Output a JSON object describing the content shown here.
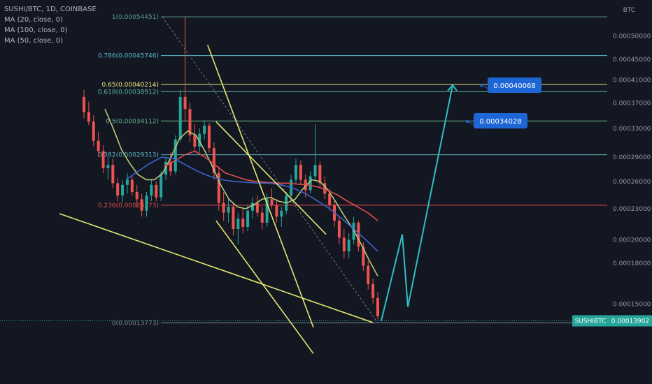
{
  "header": {
    "symbol": "SUSHI/BTC, 1D, COINBASE",
    "indicators": [
      "MA (20, close, 0)",
      "MA (100, close, 0)",
      "MA (50, close, 0)"
    ],
    "unit": "BTC"
  },
  "price_tag": {
    "symbol": "SUSHIBTC",
    "value": "0.00013902"
  },
  "callouts": [
    "0.00040068",
    "0.00034028"
  ],
  "colors": {
    "bg": "#131722",
    "up": "#26a69a",
    "down": "#ef5350",
    "ma20": "#b5c97a",
    "ma50": "#e24c4c",
    "ma100": "#3a63c9",
    "trend": "#e6e672",
    "arrow": "#2ebfc2",
    "callout": "#1e66d6",
    "tag": "#26a69a"
  },
  "chart_data": {
    "type": "candlestick",
    "y_axis_ticks": [
      "0.00050000",
      "0.00045000",
      "0.00041000",
      "0.00037000",
      "0.00033000",
      "0.00029000",
      "0.00026000",
      "0.00023000",
      "0.00020000",
      "0.00018000",
      "0.00015000"
    ],
    "fib_levels": [
      {
        "label": "1(0.00054451)",
        "value": 0.00054451,
        "color": "#5b9c8f"
      },
      {
        "label": "0.786(0.00045746)",
        "value": 0.00045746,
        "color": "#5ab9c9"
      },
      {
        "label": "0.65(0.00040214)",
        "value": 0.00040214,
        "color": "#f0eb7a"
      },
      {
        "label": "0.618(0.00038912)",
        "value": 0.00038912,
        "color": "#5bbaa5"
      },
      {
        "label": "0.5(0.00034112)",
        "value": 0.00034112,
        "color": "#67b089"
      },
      {
        "label": "0.382(0.00029313)",
        "value": 0.00029313,
        "color": "#5cb5c0"
      },
      {
        "label": "0.236(0.00023373)",
        "value": 0.00023373,
        "color": "#e04a4a"
      },
      {
        "label": "0(0.00013773)",
        "value": 0.00013773,
        "color": "#7a8a95"
      }
    ],
    "last_price": 0.00013902,
    "targets": [
      0.00040068,
      0.00034028
    ],
    "trendlines": [
      {
        "from": [
          0.0,
          0.000225
        ],
        "to": [
          0.74,
          0.000138
        ]
      },
      {
        "from": [
          0.35,
          0.00048
        ],
        "to": [
          0.6,
          0.000135
        ]
      },
      {
        "from": [
          0.37,
          0.00034
        ],
        "to": [
          0.63,
          0.000205
        ]
      },
      {
        "from": [
          0.37,
          0.000218
        ],
        "to": [
          0.6,
          0.00012
        ]
      }
    ],
    "series": [
      {
        "type": "candles",
        "values": [
          [
            0.00038,
            0.000392,
            0.000345,
            0.000355
          ],
          [
            0.000355,
            0.000372,
            0.000335,
            0.00034
          ],
          [
            0.00034,
            0.00035,
            0.000305,
            0.000312
          ],
          [
            0.000312,
            0.000325,
            0.00029,
            0.000298
          ],
          [
            0.000298,
            0.000306,
            0.00027,
            0.000276
          ],
          [
            0.000276,
            0.00029,
            0.000262,
            0.00028
          ],
          [
            0.00028,
            0.000288,
            0.000252,
            0.000258
          ],
          [
            0.000258,
            0.000264,
            0.000238,
            0.000244
          ],
          [
            0.000244,
            0.000262,
            0.000236,
            0.000256
          ],
          [
            0.000256,
            0.00027,
            0.000246,
            0.000262
          ],
          [
            0.000262,
            0.000266,
            0.000244,
            0.000248
          ],
          [
            0.000248,
            0.000256,
            0.000232,
            0.00024
          ],
          [
            0.00024,
            0.000246,
            0.000222,
            0.000228
          ],
          [
            0.000228,
            0.000248,
            0.000222,
            0.000244
          ],
          [
            0.000244,
            0.000262,
            0.000238,
            0.000256
          ],
          [
            0.000256,
            0.00026,
            0.000238,
            0.000242
          ],
          [
            0.000242,
            0.000272,
            0.000238,
            0.000268
          ],
          [
            0.000268,
            0.00029,
            0.000262,
            0.000284
          ],
          [
            0.000284,
            0.000296,
            0.000266,
            0.000272
          ],
          [
            0.000272,
            0.00032,
            0.000268,
            0.000314
          ],
          [
            0.000314,
            0.000392,
            0.00031,
            0.00038
          ],
          [
            0.00038,
            0.000545,
            0.00034,
            0.00036
          ],
          [
            0.00036,
            0.00037,
            0.00031,
            0.00032
          ],
          [
            0.00032,
            0.000336,
            0.000296,
            0.000304
          ],
          [
            0.000304,
            0.00033,
            0.000296,
            0.000322
          ],
          [
            0.000322,
            0.000342,
            0.000314,
            0.000334
          ],
          [
            0.000334,
            0.000338,
            0.000296,
            0.000302
          ],
          [
            0.000302,
            0.00031,
            0.000262,
            0.00027
          ],
          [
            0.00027,
            0.000278,
            0.000228,
            0.000236
          ],
          [
            0.000236,
            0.000248,
            0.000218,
            0.000226
          ],
          [
            0.000226,
            0.00024,
            0.000216,
            0.000232
          ],
          [
            0.000232,
            0.000236,
            0.000204,
            0.00021
          ],
          [
            0.00021,
            0.000226,
            0.000196,
            0.00022
          ],
          [
            0.00022,
            0.00023,
            0.000206,
            0.000212
          ],
          [
            0.000212,
            0.000234,
            0.000208,
            0.000228
          ],
          [
            0.000228,
            0.000242,
            0.00022,
            0.000236
          ],
          [
            0.000236,
            0.000244,
            0.000222,
            0.000226
          ],
          [
            0.000226,
            0.000232,
            0.00021,
            0.000216
          ],
          [
            0.000216,
            0.000246,
            0.000212,
            0.00024
          ],
          [
            0.00024,
            0.000252,
            0.00023,
            0.000234
          ],
          [
            0.000234,
            0.00024,
            0.000216,
            0.000222
          ],
          [
            0.000222,
            0.000232,
            0.000212,
            0.000228
          ],
          [
            0.000228,
            0.000248,
            0.000224,
            0.000244
          ],
          [
            0.000244,
            0.000268,
            0.00024,
            0.000262
          ],
          [
            0.000262,
            0.000288,
            0.000258,
            0.00028
          ],
          [
            0.00028,
            0.000286,
            0.000256,
            0.000262
          ],
          [
            0.000262,
            0.000268,
            0.000242,
            0.00025
          ],
          [
            0.00025,
            0.000272,
            0.000246,
            0.000266
          ],
          [
            0.000266,
            0.000336,
            0.000262,
            0.00028
          ],
          [
            0.00028,
            0.000284,
            0.000252,
            0.000258
          ],
          [
            0.000258,
            0.000266,
            0.00024,
            0.000246
          ],
          [
            0.000246,
            0.000252,
            0.000228,
            0.000234
          ],
          [
            0.000234,
            0.000238,
            0.000212,
            0.000218
          ],
          [
            0.000218,
            0.000222,
            0.000196,
            0.000202
          ],
          [
            0.000202,
            0.00021,
            0.000184,
            0.00019
          ],
          [
            0.00019,
            0.000206,
            0.000184,
            0.0002
          ],
          [
            0.0002,
            0.000222,
            0.000196,
            0.000216
          ],
          [
            0.000216,
            0.000218,
            0.00019,
            0.000194
          ],
          [
            0.000194,
            0.000198,
            0.000174,
            0.000178
          ],
          [
            0.000178,
            0.000182,
            0.00016,
            0.000164
          ],
          [
            0.000164,
            0.000168,
            0.00015,
            0.000154
          ],
          [
            0.000154,
            0.000158,
            0.00014,
            0.000142
          ]
        ]
      },
      {
        "name": "MA (20, close, 0)",
        "values": [
          0.00036,
          0.00033,
          0.0003,
          0.000282,
          0.000268,
          0.000262,
          0.000262,
          0.00027,
          0.00029,
          0.000315,
          0.000326,
          0.00032,
          0.0003,
          0.000278,
          0.000256,
          0.00024,
          0.000232,
          0.00023,
          0.000234,
          0.00024,
          0.000242,
          0.000238,
          0.000236,
          0.00024,
          0.000252,
          0.000262,
          0.00026,
          0.00025,
          0.000236,
          0.000222,
          0.00021,
          0.000196,
          0.000182,
          0.00017
        ]
      },
      {
        "name": "MA (50, close, 0)",
        "values": [
          0.000278,
          0.000285,
          0.000293,
          0.000298,
          0.00029,
          0.00028,
          0.00027,
          0.000266,
          0.000262,
          0.00026,
          0.000259,
          0.000258,
          0.000258,
          0.000257,
          0.000256,
          0.000254,
          0.00025,
          0.000245,
          0.000238,
          0.000232,
          0.000226,
          0.000218
        ]
      },
      {
        "name": "MA (100, close, 0)",
        "values": [
          0.000262,
          0.000272,
          0.000282,
          0.00029,
          0.000288,
          0.00028,
          0.000272,
          0.000266,
          0.000262,
          0.00026,
          0.000259,
          0.000258,
          0.000258,
          0.000256,
          0.000252,
          0.000246,
          0.000238,
          0.00023,
          0.00022,
          0.00021,
          0.0002,
          0.00019
        ]
      }
    ]
  }
}
